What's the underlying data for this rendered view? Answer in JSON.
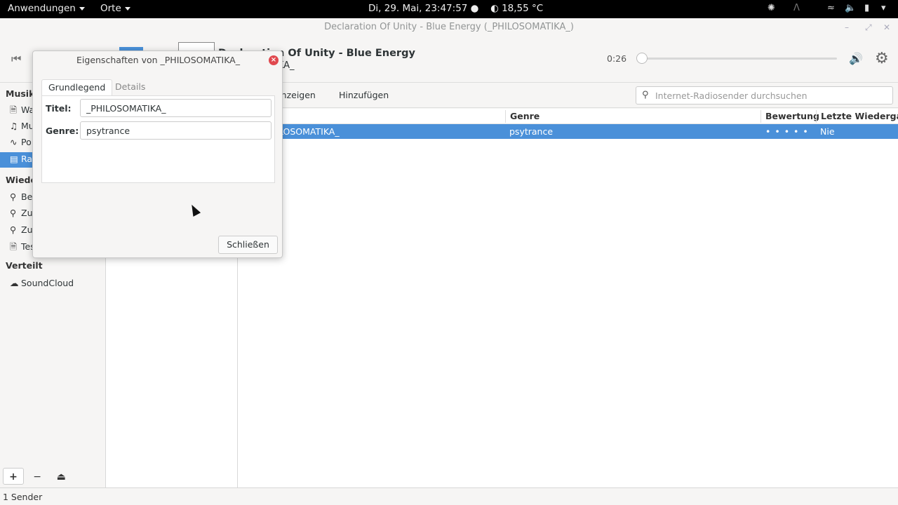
{
  "topbar": {
    "apps": "Anwendungen",
    "places": "Orte",
    "datetime": "Di, 29. Mai, 23:47:57 ●",
    "weather": "18,55 °C"
  },
  "window": {
    "title": "Declaration Of Unity - Blue Energy (_PHILOSOMATIKA_)",
    "controls": [
      "–",
      "⤢",
      "✕"
    ]
  },
  "player": {
    "song_title": "Declaration Of Unity - Blue Energy",
    "song_title_visible": "D..........Of Unity - Blue Energy",
    "artist_visible": "IKA_",
    "time": "0:26",
    "progress": 0.0
  },
  "sidebar": {
    "sections": [
      {
        "label": "Musiks",
        "items": [
          {
            "icon": "document-icon",
            "label": "Wa"
          },
          {
            "icon": "music-note-icon",
            "label": "Mu"
          },
          {
            "icon": "podcast-icon",
            "label": "Po"
          },
          {
            "icon": "radio-icon",
            "label": "Ra",
            "selected": true
          }
        ]
      },
      {
        "label": "Wieder",
        "items": [
          {
            "icon": "search-icon",
            "label": "Be"
          },
          {
            "icon": "search-icon",
            "label": "Zu"
          },
          {
            "icon": "search-icon",
            "label": "Zu"
          },
          {
            "icon": "document-icon",
            "label": "Tes"
          }
        ]
      },
      {
        "label": "Verteilt",
        "items": [
          {
            "icon": "cloud-icon",
            "label": "SoundCloud"
          }
        ]
      }
    ],
    "tools": [
      "+",
      "−",
      "⏏"
    ]
  },
  "toolbar": {
    "show_label": "anzeigen",
    "add_label": "Hinzufügen",
    "search_placeholder": "Internet-Radiosender durchsuchen"
  },
  "table": {
    "columns": [
      "Genre",
      "Bewertung",
      "Letzte Wiedergabe"
    ],
    "rows": [
      {
        "title": "LOSOMATIKA_",
        "genre": "psytrance",
        "rating": "• • • • •",
        "last_played": "Nie"
      }
    ]
  },
  "status": "1 Sender",
  "dialog": {
    "title": "Eigenschaften von _PHILOSOMATIKA_",
    "tabs": [
      "Grundlegend",
      "Details"
    ],
    "fields": {
      "title_label": "Titel:",
      "title_value": "_PHILOSOMATIKA_",
      "genre_label": "Genre:",
      "genre_value": "psytrance"
    },
    "close_label": "Schließen"
  },
  "colors": {
    "accent": "#4a90d9",
    "close_red": "#e0484e"
  }
}
